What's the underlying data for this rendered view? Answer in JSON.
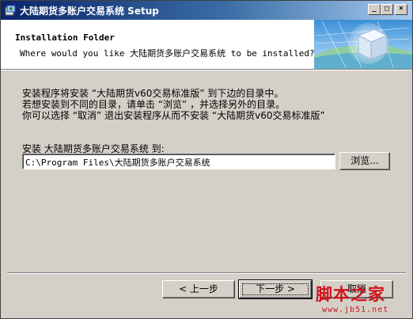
{
  "window": {
    "title": "大陆期货多账户交易系统 Setup",
    "controls": {
      "minimize": "_",
      "maximize": "□",
      "close": "×"
    }
  },
  "header": {
    "title": "Installation Folder",
    "subtitle": "Where would you like 大陆期货多账户交易系统 to be installed?",
    "graphic_icon": "install-box-globe-icon"
  },
  "body": {
    "description": [
      "安装程序将安装 “大陆期货v60交易标准版” 到下边的目录中。",
      "若想安装到不同的目录，请单击 “浏览” ，并选择另外的目录。",
      "你可以选择 “取消” 退出安装程序从而不安装 “大陆期货v60交易标准版”"
    ],
    "install_label": "安装 大陆期货多账户交易系统 到:",
    "install_path": "C:\\Program Files\\大陆期货多账户交易系统",
    "browse_button": "浏览..."
  },
  "footer": {
    "back_button": "< 上一步",
    "next_button": "下一步 >",
    "cancel_button": "取消"
  },
  "watermark": {
    "text": "脚本之家",
    "url": "www.jb51.net"
  }
}
